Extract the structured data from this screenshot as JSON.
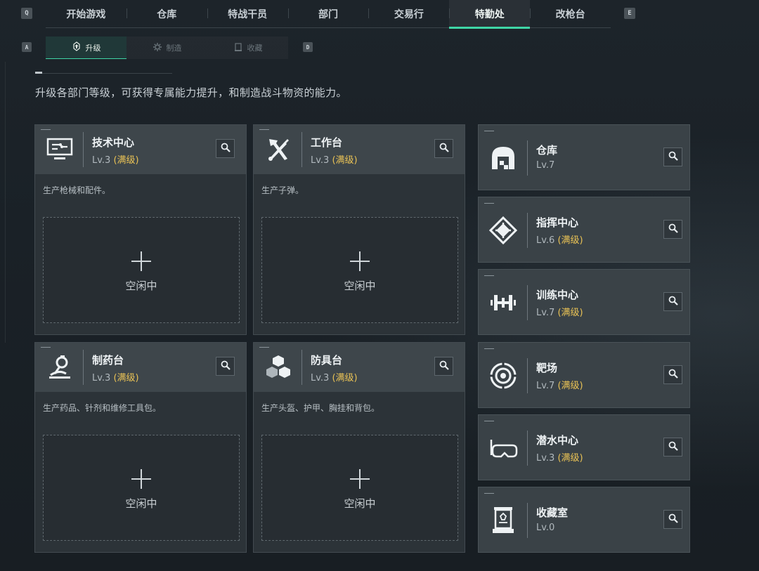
{
  "nav": {
    "left_key": "Q",
    "right_key": "E",
    "tabs": [
      {
        "label": "开始游戏"
      },
      {
        "label": "仓库"
      },
      {
        "label": "特战干员"
      },
      {
        "label": "部门"
      },
      {
        "label": "交易行"
      },
      {
        "label": "特勤处",
        "active": true
      },
      {
        "label": "改枪台"
      }
    ]
  },
  "subnav": {
    "left_key": "A",
    "right_key": "D",
    "tabs": [
      {
        "label": "升级",
        "icon": "upgrade-icon",
        "active": true
      },
      {
        "label": "制造",
        "icon": "craft-icon"
      },
      {
        "label": "收藏",
        "icon": "collection-icon"
      }
    ]
  },
  "description": "升级各部门等级，可获得专属能力提升，和制造战斗物资的能力。",
  "colors": {
    "accent": "#3fd6a6",
    "max_level": "#e9c255"
  },
  "production": [
    {
      "name": "技术中心",
      "level": "Lv.3",
      "max": "(满级)",
      "desc": "生产枪械和配件。",
      "status": "空闲中",
      "icon": "computer-icon"
    },
    {
      "name": "工作台",
      "level": "Lv.3",
      "max": "(满级)",
      "desc": "生产子弹。",
      "status": "空闲中",
      "icon": "tools-icon"
    },
    {
      "name": "制药台",
      "level": "Lv.3",
      "max": "(满级)",
      "desc": "生产药品、针剂和维修工具包。",
      "status": "空闲中",
      "icon": "microscope-icon"
    },
    {
      "name": "防具台",
      "level": "Lv.3",
      "max": "(满级)",
      "desc": "生产头盔、护甲、胸挂和背包。",
      "status": "空闲中",
      "icon": "cubes-icon"
    }
  ],
  "facilities": [
    {
      "name": "仓库",
      "level": "Lv.7",
      "max": "",
      "icon": "warehouse-icon"
    },
    {
      "name": "指挥中心",
      "level": "Lv.6",
      "max": "(满级)",
      "icon": "chip-icon"
    },
    {
      "name": "训练中心",
      "level": "Lv.7",
      "max": "(满级)",
      "icon": "dumbbell-icon"
    },
    {
      "name": "靶场",
      "level": "Lv.7",
      "max": "(满级)",
      "icon": "target-icon"
    },
    {
      "name": "潜水中心",
      "level": "Lv.3",
      "max": "(满级)",
      "icon": "diving-mask-icon"
    },
    {
      "name": "收藏室",
      "level": "Lv.0",
      "max": "",
      "icon": "display-case-icon"
    }
  ]
}
